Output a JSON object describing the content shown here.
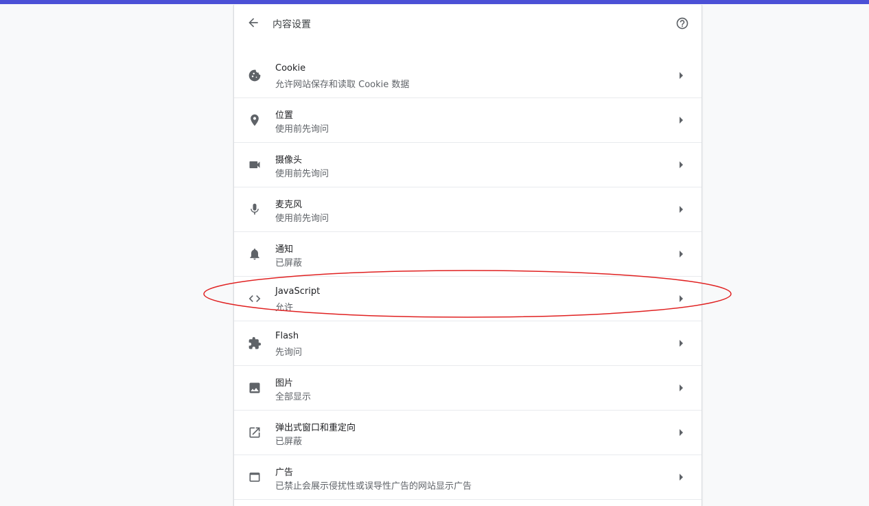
{
  "header": {
    "title": "内容设置"
  },
  "colors": {
    "top_bar": "#4b50d6",
    "highlight_ring": "#e02020",
    "icon": "#5f6368"
  },
  "settings": [
    {
      "id": "cookie",
      "title": "Cookie",
      "subtitle": "允许网站保存和读取 Cookie 数据",
      "icon": "cookie-icon"
    },
    {
      "id": "location",
      "title": "位置",
      "subtitle": "使用前先询问",
      "icon": "location-pin-icon"
    },
    {
      "id": "camera",
      "title": "摄像头",
      "subtitle": "使用前先询问",
      "icon": "camera-icon"
    },
    {
      "id": "microphone",
      "title": "麦克风",
      "subtitle": "使用前先询问",
      "icon": "microphone-icon"
    },
    {
      "id": "notifications",
      "title": "通知",
      "subtitle": "已屏蔽",
      "icon": "bell-icon"
    },
    {
      "id": "javascript",
      "title": "JavaScript",
      "subtitle": "允许",
      "icon": "code-icon"
    },
    {
      "id": "flash",
      "title": "Flash",
      "subtitle": "先询问",
      "icon": "puzzle-icon"
    },
    {
      "id": "images",
      "title": "图片",
      "subtitle": "全部显示",
      "icon": "image-icon"
    },
    {
      "id": "popups",
      "title": "弹出式窗口和重定向",
      "subtitle": "已屏蔽",
      "icon": "open-in-new-icon"
    },
    {
      "id": "ads",
      "title": "广告",
      "subtitle": "已禁止会展示侵扰性或误导性广告的网站显示广告",
      "icon": "window-icon"
    }
  ]
}
